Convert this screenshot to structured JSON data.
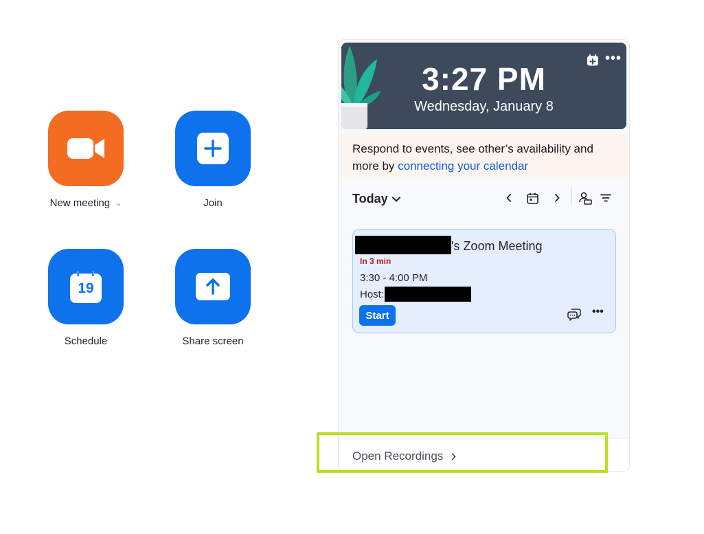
{
  "actions": {
    "new_meeting": "New meeting",
    "join": "Join",
    "schedule": "Schedule",
    "schedule_day": "19",
    "share_screen": "Share screen"
  },
  "panel": {
    "time": "3:27 PM",
    "date": "Wednesday, January 8",
    "notice_text": "Respond to events, see other’s availability and more by ",
    "notice_link": "connecting your calendar",
    "today_label": "Today",
    "meeting": {
      "title_suffix": "'s Zoom Meeting",
      "status": "In 3 min",
      "time_range": "3:30 - 4:00 PM",
      "host_label": "Host:",
      "start_label": "Start"
    },
    "open_recordings": "Open Recordings"
  },
  "colors": {
    "accent_blue": "#0e72ed",
    "new_meeting_orange": "#f26d21",
    "header_bg": "#3c4a5c",
    "highlight": "#b9e021"
  }
}
